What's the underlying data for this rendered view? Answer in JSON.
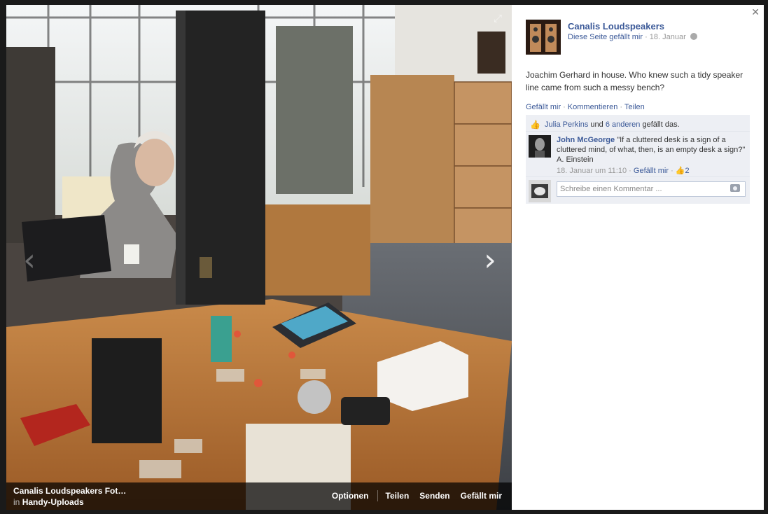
{
  "photo": {
    "expand_icon": "expand-icon",
    "prev_icon": "chevron-left-icon",
    "next_icon": "chevron-right-icon",
    "prev_glyph": "‹",
    "next_glyph": "›"
  },
  "caption": {
    "title": "Canalis Loudspeakers Fot…",
    "album_prefix": "in",
    "album_name": "Handy-Uploads",
    "actions": {
      "options": "Optionen",
      "share": "Teilen",
      "send": "Senden",
      "like": "Gefällt mir"
    }
  },
  "post": {
    "page_name": "Canalis Loudspeakers",
    "page_like": "Diese Seite gefällt mir",
    "date": "18. Januar",
    "text": "Joachim Gerhard in house. Who knew such a tidy speaker line came from such a messy bench?",
    "actions": {
      "like": "Gefällt mir",
      "comment": "Kommentieren",
      "share": "Teilen",
      "sep": "·"
    }
  },
  "likes": {
    "person": "Julia Perkins",
    "and": "und",
    "others": "6 anderen",
    "suffix": "gefällt das."
  },
  "comment": {
    "author": "John McGeorge",
    "text": "\"If a cluttered desk is a sign of a cluttered mind, of what, then, is an empty desk a sign?\" A. Einstein",
    "time": "18. Januar um 11:10",
    "like": "Gefällt mir",
    "like_count": "2",
    "sep": "·"
  },
  "compose": {
    "placeholder": "Schreibe einen Kommentar ..."
  },
  "colors": {
    "link": "#3b5998",
    "ufi_bg": "#edeff4"
  }
}
